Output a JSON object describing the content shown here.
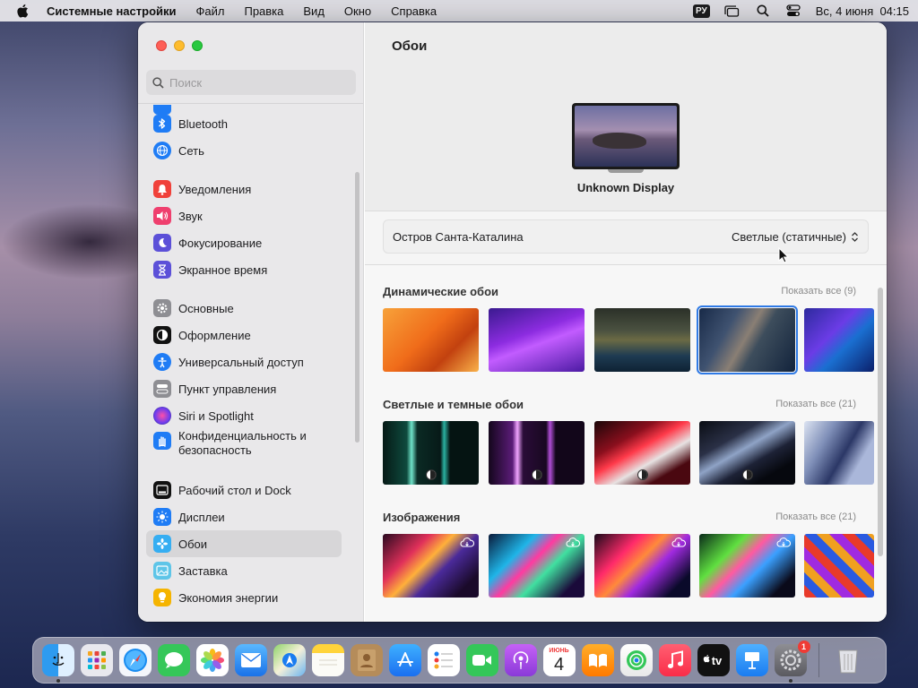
{
  "menubar": {
    "app_name": "Системные настройки",
    "menus": [
      "Файл",
      "Правка",
      "Вид",
      "Окно",
      "Справка"
    ],
    "input_source": "РУ",
    "clock": "Вс, 4 июня  04:15"
  },
  "sidebar": {
    "search_placeholder": "Поиск",
    "items": [
      {
        "label": "Bluetooth",
        "icon": "bluetooth-icon",
        "color": "#1f7cf5"
      },
      {
        "label": "Сеть",
        "icon": "globe-icon",
        "color": "#1f7cf5"
      },
      {
        "label": "Уведомления",
        "icon": "bell-icon",
        "color": "#f0413a"
      },
      {
        "label": "Звук",
        "icon": "speaker-icon",
        "color": "#ef3f6e"
      },
      {
        "label": "Фокусирование",
        "icon": "moon-icon",
        "color": "#5c50d8"
      },
      {
        "label": "Экранное время",
        "icon": "hourglass-icon",
        "color": "#5c50d8"
      },
      {
        "label": "Основные",
        "icon": "gear-icon",
        "color": "#8e8e93"
      },
      {
        "label": "Оформление",
        "icon": "appearance-icon",
        "color": "#111111"
      },
      {
        "label": "Универсальный доступ",
        "icon": "accessibility-icon",
        "color": "#1f7cf5"
      },
      {
        "label": "Пункт управления",
        "icon": "control-center-icon",
        "color": "#8e8e93"
      },
      {
        "label": "Siri и Spotlight",
        "icon": "siri-icon",
        "color": "#c03ad9"
      },
      {
        "label": "Конфиденциальность и",
        "label2": "безопасность",
        "icon": "hand-icon",
        "color": "#1f7cf5"
      },
      {
        "label": "Рабочий стол и Dock",
        "icon": "dock-icon",
        "color": "#111111"
      },
      {
        "label": "Дисплеи",
        "icon": "sun-icon",
        "color": "#1f7cf5"
      },
      {
        "label": "Обои",
        "icon": "wallpaper-icon",
        "color": "#36aef2"
      },
      {
        "label": "Заставка",
        "icon": "screensaver-icon",
        "color": "#5ec5e8"
      },
      {
        "label": "Экономия энергии",
        "icon": "bulb-icon",
        "color": "#f5b400"
      }
    ]
  },
  "main": {
    "title": "Обои",
    "display_name": "Unknown Display",
    "wallpaper_name": "Остров Санта-Каталина",
    "wallpaper_mode": "Светлые (статичные)",
    "sections": [
      {
        "title": "Динамические обои",
        "show_all": "Показать все (9)"
      },
      {
        "title": "Светлые и темные обои",
        "show_all": "Показать все (21)"
      },
      {
        "title": "Изображения",
        "show_all": "Показать все (21)"
      }
    ]
  },
  "dock": {
    "apps": [
      {
        "name": "finder-icon"
      },
      {
        "name": "launchpad-icon"
      },
      {
        "name": "safari-icon"
      },
      {
        "name": "messages-icon"
      },
      {
        "name": "photos-icon"
      },
      {
        "name": "mail-icon"
      },
      {
        "name": "maps-icon"
      },
      {
        "name": "notes-icon"
      },
      {
        "name": "contacts-icon"
      },
      {
        "name": "app-store-icon"
      },
      {
        "name": "reminders-icon"
      },
      {
        "name": "facetime-icon"
      },
      {
        "name": "podcasts-icon"
      },
      {
        "name": "calendar-icon"
      },
      {
        "name": "books-icon"
      },
      {
        "name": "find-my-icon"
      },
      {
        "name": "music-icon"
      },
      {
        "name": "apple-tv-icon"
      },
      {
        "name": "keynote-icon"
      },
      {
        "name": "system-settings-icon"
      },
      {
        "name": "trash-icon"
      }
    ],
    "calendar_month": "ИЮНЬ",
    "calendar_day": "4",
    "tv_label": "tv",
    "settings_badge": "1"
  }
}
